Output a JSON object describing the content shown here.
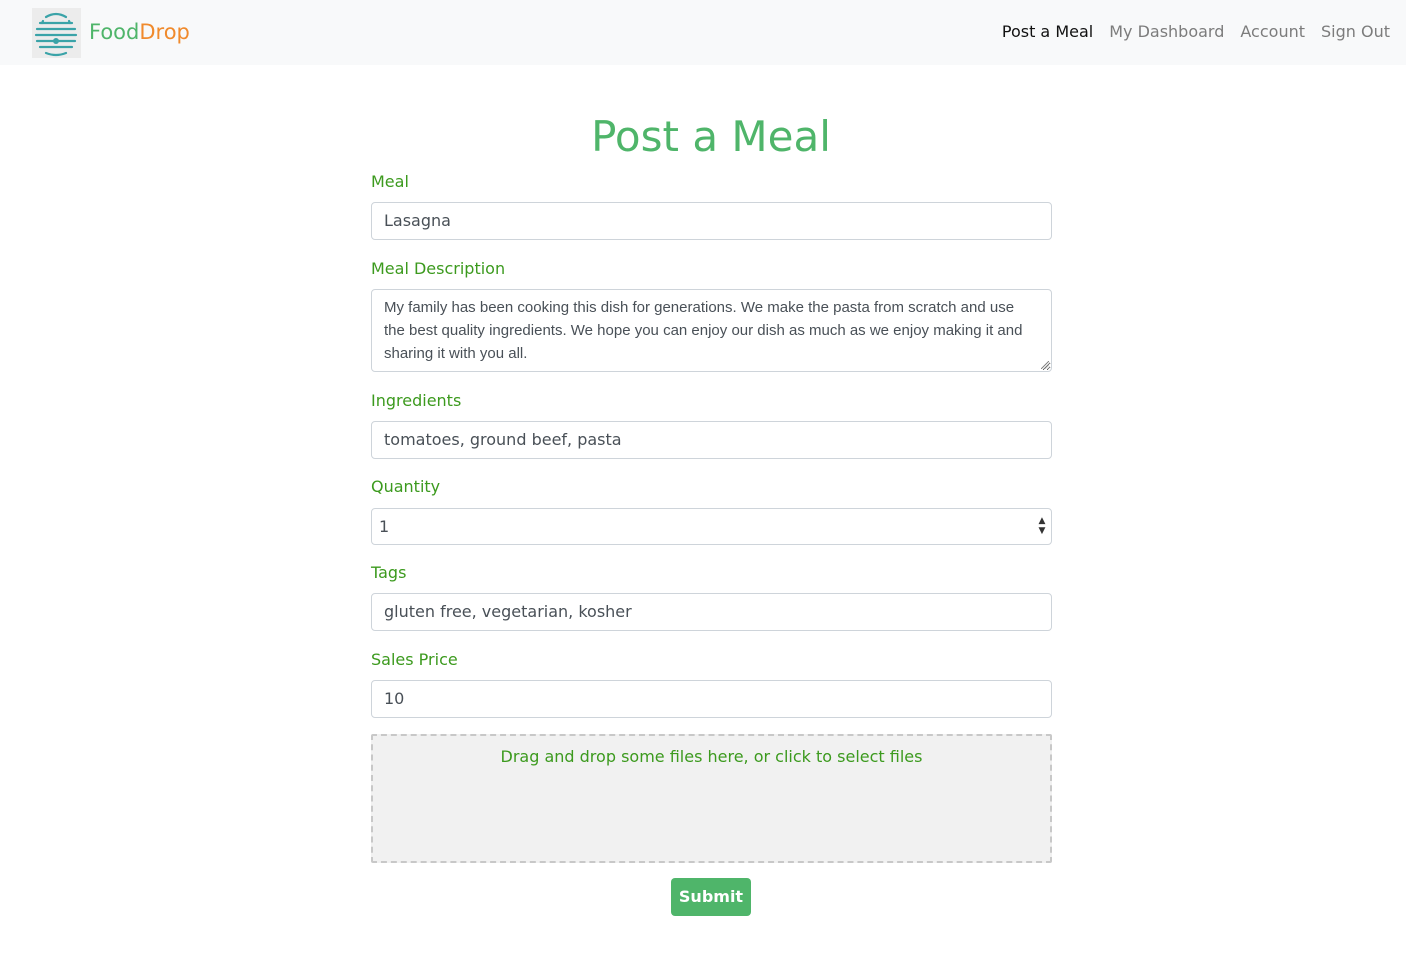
{
  "navbar": {
    "brand_food": "Food",
    "brand_drop": "Drop",
    "links": [
      {
        "label": "Post a Meal",
        "active": true
      },
      {
        "label": "My Dashboard",
        "active": false
      },
      {
        "label": "Account",
        "active": false
      },
      {
        "label": "Sign Out",
        "active": false
      }
    ]
  },
  "page": {
    "title": "Post a Meal"
  },
  "form": {
    "meal_label": "Meal",
    "meal_value": "Lasagna",
    "description_label": "Meal Description",
    "description_value": "My family has been cooking this dish for generations. We make the pasta from scratch and use the best quality ingredients. We hope you can enjoy our dish as much as we enjoy making it and sharing it with you all.",
    "ingredients_label": "Ingredients",
    "ingredients_value": "tomatoes, ground beef, pasta",
    "quantity_label": "Quantity",
    "quantity_value": "1",
    "tags_label": "Tags",
    "tags_value": "gluten free, vegetarian, kosher",
    "price_label": "Sales Price",
    "price_value": "10",
    "dropzone_text": "Drag and drop some files here, or click to select files",
    "submit_label": "Submit"
  },
  "colors": {
    "brand_green": "#4fb56a",
    "brand_orange": "#f08a2c",
    "label_green": "#3c9a1e"
  },
  "icons": {
    "logo": "beehive-logo-icon",
    "select": "updown-arrows-icon"
  }
}
